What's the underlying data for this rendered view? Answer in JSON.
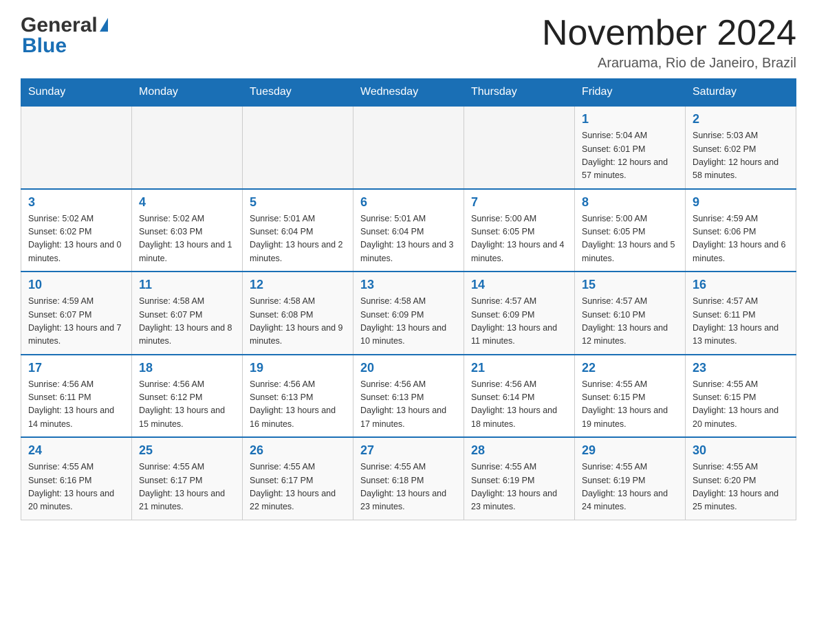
{
  "logo": {
    "general": "General",
    "blue": "Blue"
  },
  "title": {
    "month_year": "November 2024",
    "location": "Araruama, Rio de Janeiro, Brazil"
  },
  "days_of_week": [
    "Sunday",
    "Monday",
    "Tuesday",
    "Wednesday",
    "Thursday",
    "Friday",
    "Saturday"
  ],
  "weeks": [
    {
      "days": [
        {
          "empty": true
        },
        {
          "empty": true
        },
        {
          "empty": true
        },
        {
          "empty": true
        },
        {
          "empty": true
        },
        {
          "date": 1,
          "sunrise": "Sunrise: 5:04 AM",
          "sunset": "Sunset: 6:01 PM",
          "daylight": "Daylight: 12 hours and 57 minutes."
        },
        {
          "date": 2,
          "sunrise": "Sunrise: 5:03 AM",
          "sunset": "Sunset: 6:02 PM",
          "daylight": "Daylight: 12 hours and 58 minutes."
        }
      ]
    },
    {
      "days": [
        {
          "date": 3,
          "sunrise": "Sunrise: 5:02 AM",
          "sunset": "Sunset: 6:02 PM",
          "daylight": "Daylight: 13 hours and 0 minutes."
        },
        {
          "date": 4,
          "sunrise": "Sunrise: 5:02 AM",
          "sunset": "Sunset: 6:03 PM",
          "daylight": "Daylight: 13 hours and 1 minute."
        },
        {
          "date": 5,
          "sunrise": "Sunrise: 5:01 AM",
          "sunset": "Sunset: 6:04 PM",
          "daylight": "Daylight: 13 hours and 2 minutes."
        },
        {
          "date": 6,
          "sunrise": "Sunrise: 5:01 AM",
          "sunset": "Sunset: 6:04 PM",
          "daylight": "Daylight: 13 hours and 3 minutes."
        },
        {
          "date": 7,
          "sunrise": "Sunrise: 5:00 AM",
          "sunset": "Sunset: 6:05 PM",
          "daylight": "Daylight: 13 hours and 4 minutes."
        },
        {
          "date": 8,
          "sunrise": "Sunrise: 5:00 AM",
          "sunset": "Sunset: 6:05 PM",
          "daylight": "Daylight: 13 hours and 5 minutes."
        },
        {
          "date": 9,
          "sunrise": "Sunrise: 4:59 AM",
          "sunset": "Sunset: 6:06 PM",
          "daylight": "Daylight: 13 hours and 6 minutes."
        }
      ]
    },
    {
      "days": [
        {
          "date": 10,
          "sunrise": "Sunrise: 4:59 AM",
          "sunset": "Sunset: 6:07 PM",
          "daylight": "Daylight: 13 hours and 7 minutes."
        },
        {
          "date": 11,
          "sunrise": "Sunrise: 4:58 AM",
          "sunset": "Sunset: 6:07 PM",
          "daylight": "Daylight: 13 hours and 8 minutes."
        },
        {
          "date": 12,
          "sunrise": "Sunrise: 4:58 AM",
          "sunset": "Sunset: 6:08 PM",
          "daylight": "Daylight: 13 hours and 9 minutes."
        },
        {
          "date": 13,
          "sunrise": "Sunrise: 4:58 AM",
          "sunset": "Sunset: 6:09 PM",
          "daylight": "Daylight: 13 hours and 10 minutes."
        },
        {
          "date": 14,
          "sunrise": "Sunrise: 4:57 AM",
          "sunset": "Sunset: 6:09 PM",
          "daylight": "Daylight: 13 hours and 11 minutes."
        },
        {
          "date": 15,
          "sunrise": "Sunrise: 4:57 AM",
          "sunset": "Sunset: 6:10 PM",
          "daylight": "Daylight: 13 hours and 12 minutes."
        },
        {
          "date": 16,
          "sunrise": "Sunrise: 4:57 AM",
          "sunset": "Sunset: 6:11 PM",
          "daylight": "Daylight: 13 hours and 13 minutes."
        }
      ]
    },
    {
      "days": [
        {
          "date": 17,
          "sunrise": "Sunrise: 4:56 AM",
          "sunset": "Sunset: 6:11 PM",
          "daylight": "Daylight: 13 hours and 14 minutes."
        },
        {
          "date": 18,
          "sunrise": "Sunrise: 4:56 AM",
          "sunset": "Sunset: 6:12 PM",
          "daylight": "Daylight: 13 hours and 15 minutes."
        },
        {
          "date": 19,
          "sunrise": "Sunrise: 4:56 AM",
          "sunset": "Sunset: 6:13 PM",
          "daylight": "Daylight: 13 hours and 16 minutes."
        },
        {
          "date": 20,
          "sunrise": "Sunrise: 4:56 AM",
          "sunset": "Sunset: 6:13 PM",
          "daylight": "Daylight: 13 hours and 17 minutes."
        },
        {
          "date": 21,
          "sunrise": "Sunrise: 4:56 AM",
          "sunset": "Sunset: 6:14 PM",
          "daylight": "Daylight: 13 hours and 18 minutes."
        },
        {
          "date": 22,
          "sunrise": "Sunrise: 4:55 AM",
          "sunset": "Sunset: 6:15 PM",
          "daylight": "Daylight: 13 hours and 19 minutes."
        },
        {
          "date": 23,
          "sunrise": "Sunrise: 4:55 AM",
          "sunset": "Sunset: 6:15 PM",
          "daylight": "Daylight: 13 hours and 20 minutes."
        }
      ]
    },
    {
      "days": [
        {
          "date": 24,
          "sunrise": "Sunrise: 4:55 AM",
          "sunset": "Sunset: 6:16 PM",
          "daylight": "Daylight: 13 hours and 20 minutes."
        },
        {
          "date": 25,
          "sunrise": "Sunrise: 4:55 AM",
          "sunset": "Sunset: 6:17 PM",
          "daylight": "Daylight: 13 hours and 21 minutes."
        },
        {
          "date": 26,
          "sunrise": "Sunrise: 4:55 AM",
          "sunset": "Sunset: 6:17 PM",
          "daylight": "Daylight: 13 hours and 22 minutes."
        },
        {
          "date": 27,
          "sunrise": "Sunrise: 4:55 AM",
          "sunset": "Sunset: 6:18 PM",
          "daylight": "Daylight: 13 hours and 23 minutes."
        },
        {
          "date": 28,
          "sunrise": "Sunrise: 4:55 AM",
          "sunset": "Sunset: 6:19 PM",
          "daylight": "Daylight: 13 hours and 23 minutes."
        },
        {
          "date": 29,
          "sunrise": "Sunrise: 4:55 AM",
          "sunset": "Sunset: 6:19 PM",
          "daylight": "Daylight: 13 hours and 24 minutes."
        },
        {
          "date": 30,
          "sunrise": "Sunrise: 4:55 AM",
          "sunset": "Sunset: 6:20 PM",
          "daylight": "Daylight: 13 hours and 25 minutes."
        }
      ]
    }
  ],
  "colors": {
    "header_bg": "#1a6fb5",
    "header_text": "#ffffff",
    "date_number": "#1a6fb5",
    "logo_blue": "#1a6fb5"
  }
}
